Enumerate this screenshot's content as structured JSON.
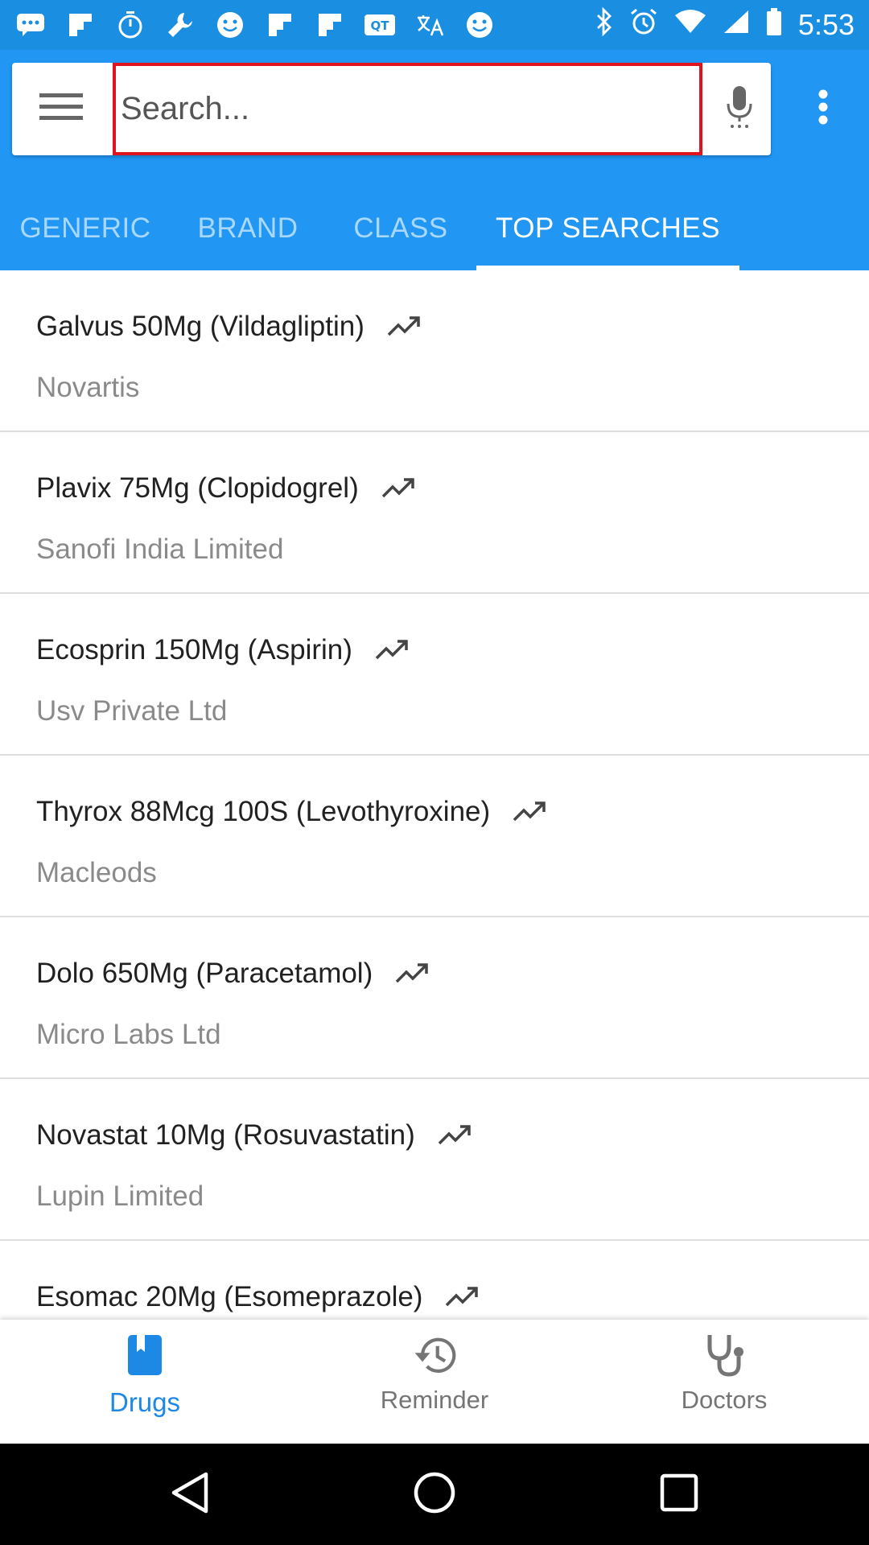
{
  "status_bar": {
    "time": "5:53",
    "notification_icons": [
      "message-icon",
      "flipboard-icon",
      "timer-icon",
      "wrench-icon",
      "smiley-icon",
      "flipboard-icon",
      "flipboard-icon",
      "qt-icon",
      "translate-icon",
      "smiley-icon"
    ],
    "system_icons": [
      "bluetooth-icon",
      "alarm-icon",
      "wifi-icon",
      "signal-icon",
      "battery-icon"
    ]
  },
  "search": {
    "placeholder": "Search..."
  },
  "tabs": [
    {
      "label": "GENERIC",
      "active": false
    },
    {
      "label": "BRAND",
      "active": false
    },
    {
      "label": "CLASS",
      "active": false
    },
    {
      "label": "TOP SEARCHES",
      "active": true
    }
  ],
  "items": [
    {
      "title": "Galvus 50Mg (Vildagliptin)",
      "maker": "Novartis"
    },
    {
      "title": "Plavix 75Mg (Clopidogrel)",
      "maker": "Sanofi India Limited"
    },
    {
      "title": "Ecosprin 150Mg (Aspirin)",
      "maker": "Usv Private Ltd"
    },
    {
      "title": "Thyrox 88Mcg 100S (Levothyroxine)",
      "maker": "Macleods"
    },
    {
      "title": "Dolo 650Mg (Paracetamol)",
      "maker": "Micro Labs Ltd"
    },
    {
      "title": "Novastat 10Mg (Rosuvastatin)",
      "maker": "Lupin Limited"
    },
    {
      "title": "Esomac 20Mg (Esomeprazole)",
      "maker": ""
    }
  ],
  "bottom_nav": {
    "drugs": "Drugs",
    "reminder": "Reminder",
    "doctors": "Doctors"
  },
  "colors": {
    "app_bar": "#2196f3",
    "status_bar": "#1a8ee0",
    "accent": "#1e88e5",
    "search_border": "#e0141e"
  }
}
